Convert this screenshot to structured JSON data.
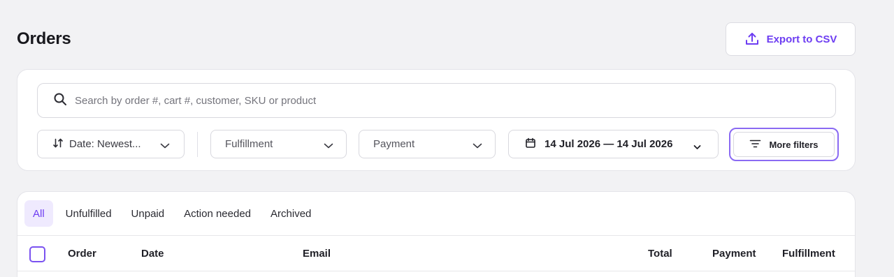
{
  "header": {
    "title": "Orders",
    "export_label": "Export to CSV"
  },
  "filters": {
    "search_placeholder": "Search by order #, cart #, customer, SKU or product",
    "sort_label": "Date: Newest...",
    "fulfillment_label": "Fulfillment",
    "payment_label": "Payment",
    "date_range": "14 Jul 2026 — 14 Jul 2026",
    "more_filters_label": "More filters"
  },
  "tabs": [
    {
      "label": "All",
      "active": true
    },
    {
      "label": "Unfulfilled",
      "active": false
    },
    {
      "label": "Unpaid",
      "active": false
    },
    {
      "label": "Action needed",
      "active": false
    },
    {
      "label": "Archived",
      "active": false
    }
  ],
  "table": {
    "columns": [
      "Order",
      "Date",
      "Email",
      "Total",
      "Payment",
      "Fulfillment"
    ]
  },
  "colors": {
    "accent": "#6d3df2",
    "background": "#f2f2f4"
  }
}
